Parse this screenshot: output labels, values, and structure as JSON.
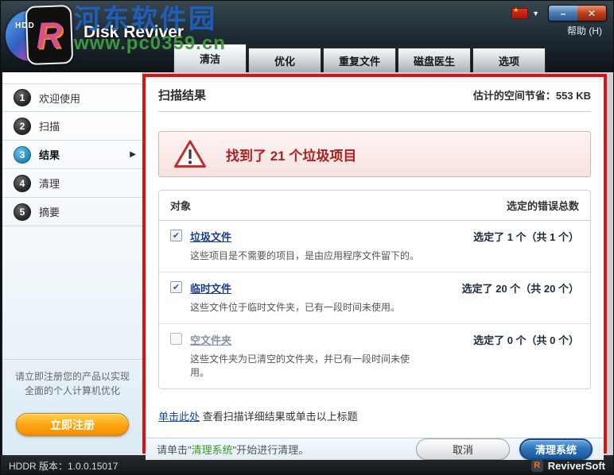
{
  "window": {
    "title": "Disk Reviver",
    "help_label": "帮助 (H)",
    "minimize_glyph": "–",
    "close_glyph": "✕",
    "caret_glyph": "▼",
    "watermark_line1": "河东软件园",
    "watermark_line2": "www.pc0359.cn",
    "logo_letter": "R",
    "logo_sub": "HDD"
  },
  "tabs": [
    {
      "label": "清洁"
    },
    {
      "label": "优化"
    },
    {
      "label": "重复文件"
    },
    {
      "label": "磁盘医生"
    },
    {
      "label": "选项"
    }
  ],
  "sidebar": {
    "steps": [
      {
        "num": "1",
        "label": "欢迎使用"
      },
      {
        "num": "2",
        "label": "扫描"
      },
      {
        "num": "3",
        "label": "结果",
        "arrow": "▶"
      },
      {
        "num": "4",
        "label": "清理"
      },
      {
        "num": "5",
        "label": "摘要"
      }
    ],
    "register_line1": "请立即注册您的产品以实现",
    "register_line2": "全面的个人计算机优化",
    "register_button": "立即注册"
  },
  "main": {
    "title": "扫描结果",
    "savings_label": "估计的空间节省：",
    "savings_value": "553 KB",
    "alert_text": "找到了 21 个垃圾项目",
    "table": {
      "col_object": "对象",
      "col_count": "选定的错误总数",
      "check_glyph": "✔",
      "rows": [
        {
          "title": "垃圾文件",
          "desc": "这些项目是不需要的项目，是由应用程序文件留下的。",
          "count": "选定了 1 个（共 1 个）"
        },
        {
          "title": "临时文件",
          "desc": "这些文件位于临时文件夹，已有一段时间未使用。",
          "count": "选定了 20 个（共 20 个）"
        },
        {
          "title": "空文件夹",
          "desc": "这些文件夹为已清空的文件夹，并已有一段时间未使用。",
          "count": "选定了 0 个（共 0 个）"
        }
      ]
    },
    "details_link": "单击此处",
    "details_rest": " 查看扫描详细结果或单击以上标题",
    "footer_pre": "请单击\"",
    "footer_highlight": "清理系统",
    "footer_post": "\"开始进行清理。",
    "cancel_button": "取消",
    "clean_button": "清理系统"
  },
  "statusbar": {
    "version": "HDDR 版本：1.0.0.15017",
    "brand": "ReviverSoft",
    "brand_icon_letter": "R"
  },
  "colors": {
    "annotation_border": "#dd1111",
    "accent_blue": "#1b57a0",
    "accent_orange": "#f08c00",
    "alert_red": "#b02020",
    "link_blue": "#1b3b8f",
    "green_highlight": "#3c9a1e"
  }
}
